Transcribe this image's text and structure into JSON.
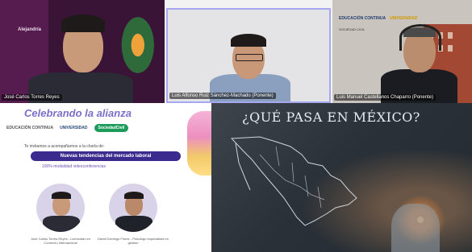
{
  "participants": [
    {
      "name": "José Carlos Torres Reyes"
    },
    {
      "name": "Luis Alfonso Ruiz Sánchez-Machado (Ponente)"
    },
    {
      "name": "Luis Manuel Castellanos Chaparro (Ponente)"
    }
  ],
  "p1_background_text": "Alejandría",
  "p3_logos": {
    "left": "EDUCACIÓN CONTINUA",
    "right": "UNIVERSIDAD",
    "sub": "SOCIEDAD CIVIL"
  },
  "poster": {
    "headline": "Celebrando la alianza",
    "logo_left": "EDUCACIÓN CONTINUA",
    "logo_mid": "UNIVERSIDAD",
    "logo_pill": "SociedadCivil",
    "invite": "Te invitamos a acompañarnos a la charla de:",
    "banner": "Nuevas tendencias del mercado laboral",
    "mode": "100% modalidad videoconferencias",
    "speakers": [
      {
        "caption": "José Carlos Torres Reyes - Licenciado en Comercio Internacional"
      },
      {
        "caption": "David Domingo Flores - Psicólogo especialista en gestión"
      }
    ]
  },
  "slide": {
    "title": "¿QUÉ PASA EN MÉXICO?"
  },
  "colors": {
    "poster_accent": "#7a6fc9",
    "banner": "#3b2b8e",
    "pill": "#1d9b5b",
    "active_border": "#a7a7f0"
  }
}
